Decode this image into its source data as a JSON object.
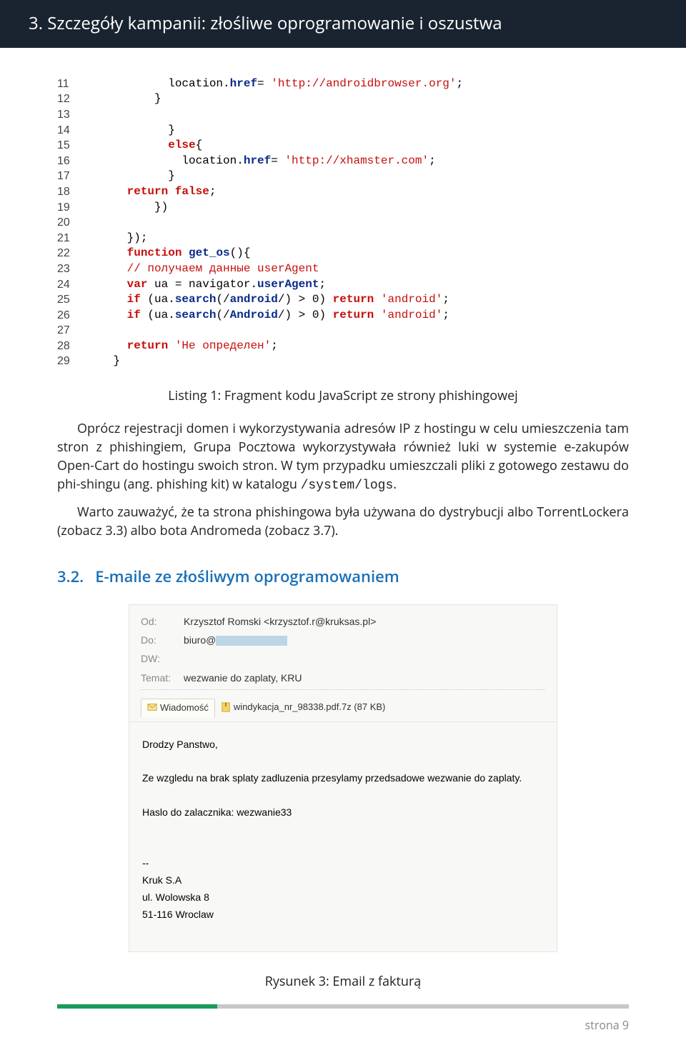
{
  "header": {
    "title": "3.   Szczegóły kampanii: złośliwe oprogramowanie i oszustwa"
  },
  "code": {
    "lines": [
      {
        "n": "11",
        "ind": 12,
        "t": [
          {
            "c": "nm",
            "s": "location."
          },
          {
            "c": "fn",
            "s": "href"
          },
          {
            "c": "nm",
            "s": "= "
          },
          {
            "c": "str",
            "s": "'http://androidbrowser.org'"
          },
          {
            "c": "nm",
            "s": ";"
          }
        ]
      },
      {
        "n": "12",
        "ind": 10,
        "t": [
          {
            "c": "nm",
            "s": "}"
          }
        ]
      },
      {
        "n": "13",
        "ind": 0,
        "t": []
      },
      {
        "n": "14",
        "ind": 12,
        "t": [
          {
            "c": "nm",
            "s": "}"
          }
        ]
      },
      {
        "n": "15",
        "ind": 12,
        "t": [
          {
            "c": "kw",
            "s": "else"
          },
          {
            "c": "nm",
            "s": "{"
          }
        ]
      },
      {
        "n": "16",
        "ind": 14,
        "t": [
          {
            "c": "nm",
            "s": "location."
          },
          {
            "c": "fn",
            "s": "href"
          },
          {
            "c": "nm",
            "s": "= "
          },
          {
            "c": "str",
            "s": "'http://xhamster.com'"
          },
          {
            "c": "nm",
            "s": ";"
          }
        ]
      },
      {
        "n": "17",
        "ind": 12,
        "t": [
          {
            "c": "nm",
            "s": "}"
          }
        ]
      },
      {
        "n": "18",
        "ind": 6,
        "t": [
          {
            "c": "kw",
            "s": "return false"
          },
          {
            "c": "nm",
            "s": ";"
          }
        ]
      },
      {
        "n": "19",
        "ind": 10,
        "t": [
          {
            "c": "nm",
            "s": "})"
          }
        ]
      },
      {
        "n": "20",
        "ind": 0,
        "t": []
      },
      {
        "n": "21",
        "ind": 6,
        "t": [
          {
            "c": "nm",
            "s": "});"
          }
        ]
      },
      {
        "n": "22",
        "ind": 6,
        "t": [
          {
            "c": "kw",
            "s": "function"
          },
          {
            "c": "nm",
            "s": " "
          },
          {
            "c": "fn",
            "s": "get_os"
          },
          {
            "c": "nm",
            "s": "(){"
          }
        ]
      },
      {
        "n": "23",
        "ind": 6,
        "t": [
          {
            "c": "cm",
            "s": "// получаем данные userAgent"
          }
        ]
      },
      {
        "n": "24",
        "ind": 6,
        "t": [
          {
            "c": "kw",
            "s": "var"
          },
          {
            "c": "nm",
            "s": " ua = navigator."
          },
          {
            "c": "fn",
            "s": "userAgent"
          },
          {
            "c": "nm",
            "s": ";"
          }
        ]
      },
      {
        "n": "25",
        "ind": 6,
        "t": [
          {
            "c": "kw",
            "s": "if"
          },
          {
            "c": "nm",
            "s": " (ua."
          },
          {
            "c": "fn",
            "s": "search"
          },
          {
            "c": "nm",
            "s": "(/"
          },
          {
            "c": "fn",
            "s": "android"
          },
          {
            "c": "nm",
            "s": "/) > 0) "
          },
          {
            "c": "kw",
            "s": "return"
          },
          {
            "c": "nm",
            "s": " "
          },
          {
            "c": "str",
            "s": "'android'"
          },
          {
            "c": "nm",
            "s": ";"
          }
        ]
      },
      {
        "n": "26",
        "ind": 6,
        "t": [
          {
            "c": "kw",
            "s": "if"
          },
          {
            "c": "nm",
            "s": " (ua."
          },
          {
            "c": "fn",
            "s": "search"
          },
          {
            "c": "nm",
            "s": "(/"
          },
          {
            "c": "fn",
            "s": "Android"
          },
          {
            "c": "nm",
            "s": "/) > 0) "
          },
          {
            "c": "kw",
            "s": "return"
          },
          {
            "c": "nm",
            "s": " "
          },
          {
            "c": "str",
            "s": "'android'"
          },
          {
            "c": "nm",
            "s": ";"
          }
        ]
      },
      {
        "n": "27",
        "ind": 0,
        "t": []
      },
      {
        "n": "28",
        "ind": 6,
        "t": [
          {
            "c": "kw",
            "s": "return"
          },
          {
            "c": "nm",
            "s": " "
          },
          {
            "c": "str",
            "s": "'Не определен'"
          },
          {
            "c": "nm",
            "s": ";"
          }
        ]
      },
      {
        "n": "29",
        "ind": 4,
        "t": [
          {
            "c": "nm",
            "s": "}"
          }
        ]
      }
    ]
  },
  "listing_caption": "Listing 1: Fragment kodu JavaScript ze strony phishingowej",
  "para1_a": "Oprócz rejestracji domen i wykorzystywania adresów IP z hostingu w celu umieszczenia tam stron z phishingiem, Grupa Pocztowa wykorzystywała również luki w systemie e-zakupów Open-Cart do hostingu swoich stron. W tym przypadku umieszczali pliki z gotowego zestawu do phi-shingu (ang. phishing kit) w katalogu ",
  "para1_code": "/system/logs",
  "para1_b": ".",
  "para2": "Warto zauważyć, że ta strona phishingowa była używana do dystrybucji albo TorrentLockera (zobacz 3.3) albo bota Andromeda (zobacz 3.7).",
  "section": {
    "num": "3.2.",
    "title": "E-maile ze złośliwym oprogramowaniem"
  },
  "email": {
    "labels": {
      "from": "Od:",
      "to": "Do:",
      "cc": "DW:",
      "subj": "Temat:",
      "attach_tab": "Wiadomość"
    },
    "from": "Krzysztof Romski <krzysztof.r@kruksas.pl>",
    "to": "biuro@",
    "cc": "",
    "subject": "wezwanie do zaplaty, KRU",
    "attachment": "windykacja_nr_98338.pdf.7z (87 KB)",
    "body_lines": [
      "Drodzy Panstwo,",
      "",
      "Ze wzgledu na brak splaty zadluzenia przesylamy przedsadowe wezwanie do zaplaty.",
      "",
      "Haslo do zalacznika: wezwanie33",
      "",
      "",
      "--",
      "Kruk S.A",
      "ul. Wolowska 8",
      "51-116 Wroclaw"
    ]
  },
  "figure_caption": "Rysunek 3: Email z fakturą",
  "page_num": "strona 9"
}
